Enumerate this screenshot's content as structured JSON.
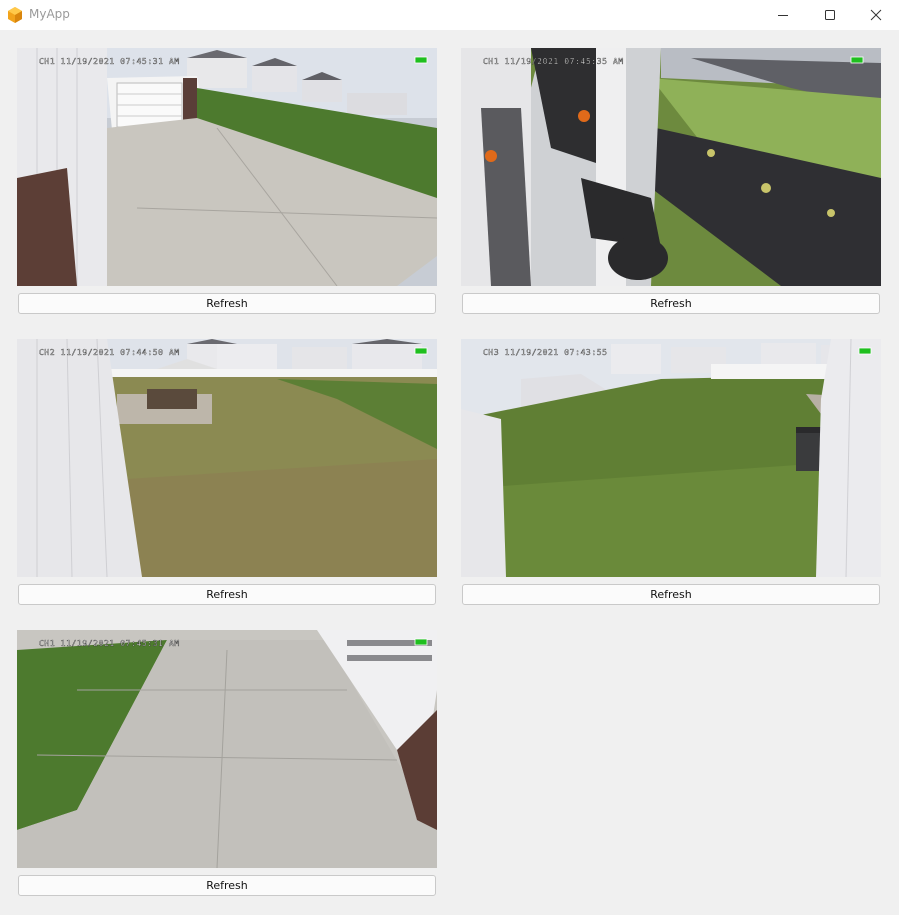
{
  "window": {
    "title": "MyApp",
    "icon": "app-cube-icon",
    "controls": [
      "minimize-icon",
      "maximize-icon",
      "close-icon"
    ]
  },
  "cameras": [
    {
      "osd": "CH1 11/19/2021 07:45:31 AM",
      "button_label": "Refresh"
    },
    {
      "osd": "CH1 11/19/2021 07:45:35 AM",
      "button_label": "Refresh"
    },
    {
      "osd": "CH2 11/19/2021 07:44:50 AM",
      "button_label": "Refresh"
    },
    {
      "osd": "CH3 11/19/2021 07:43:55",
      "button_label": "Refresh"
    },
    {
      "osd": "CH1 11/19/2021 07:45:31 AM",
      "button_label": "Refresh"
    }
  ],
  "colors": {
    "window_bg": "#f0f0f0",
    "titlebar_bg": "#ffffff",
    "app_icon": "#f2a31b",
    "button_border": "#c9c9c9"
  }
}
